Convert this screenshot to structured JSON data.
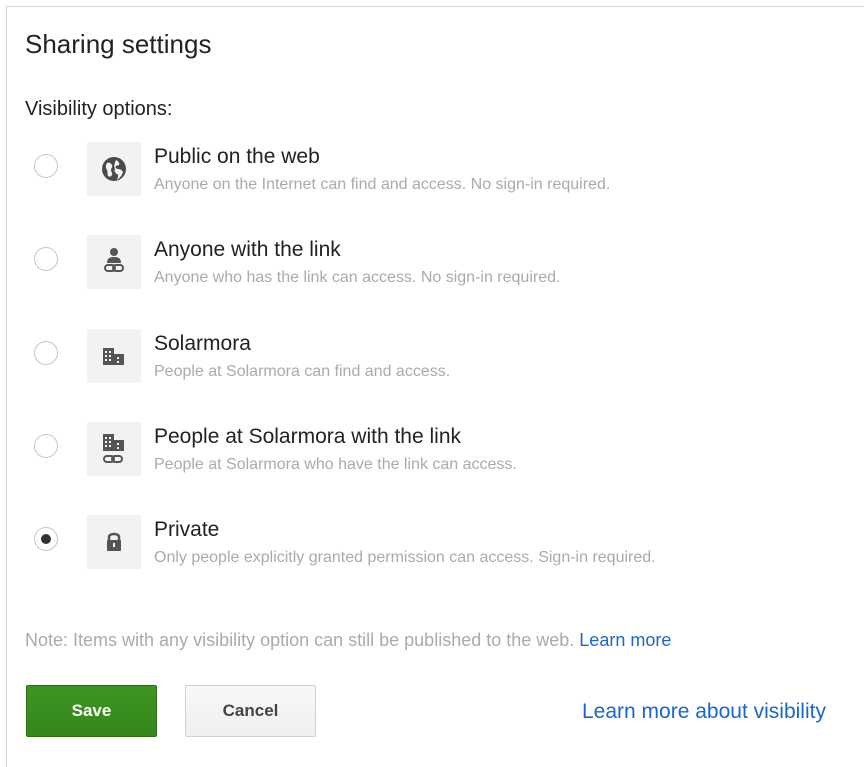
{
  "dialog": {
    "title": "Sharing settings",
    "subheading": "Visibility options:"
  },
  "options": [
    {
      "label": "Public on the web",
      "description": "Anyone on the Internet can find and access. No sign-in required.",
      "icon": "globe-icon",
      "selected": false
    },
    {
      "label": "Anyone with the link",
      "description": "Anyone who has the link can access. No sign-in required.",
      "icon": "person-link-icon",
      "selected": false
    },
    {
      "label": "Solarmora",
      "description": "People at Solarmora can find and access.",
      "icon": "building-icon",
      "selected": false
    },
    {
      "label": "People at Solarmora with the link",
      "description": "People at Solarmora who have the link can access.",
      "icon": "building-link-icon",
      "selected": false
    },
    {
      "label": "Private",
      "description": "Only people explicitly granted permission can access. Sign-in required.",
      "icon": "lock-icon",
      "selected": true
    }
  ],
  "note": {
    "text": "Note: Items with any visibility option can still be published to the web. ",
    "link": "Learn more"
  },
  "buttons": {
    "save": "Save",
    "cancel": "Cancel"
  },
  "learn_more_visibility": "Learn more about visibility",
  "colors": {
    "accent_link": "#1a66cc",
    "save_button": "#3b8d1f"
  }
}
